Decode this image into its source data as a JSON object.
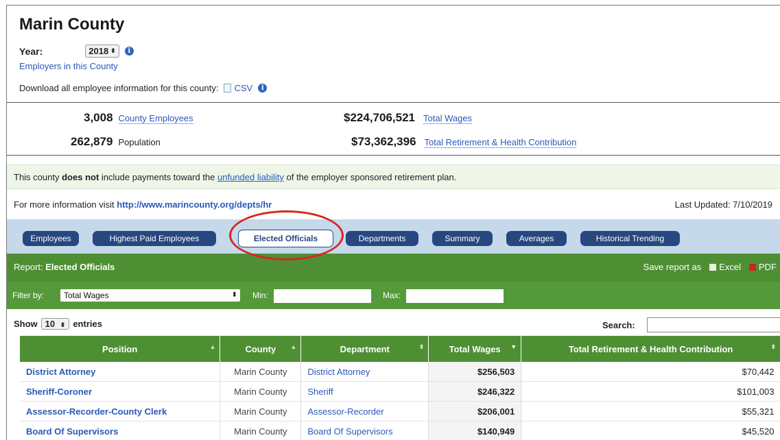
{
  "header": {
    "title": "Marin County",
    "year_label": "Year:",
    "year_value": "2018",
    "employers_link": "Employers in this County",
    "download_label": "Download all employee information for this county:",
    "csv_label": "CSV"
  },
  "stats": {
    "employees_num": "3,008",
    "employees_label": "County Employees",
    "population_num": "262,879",
    "population_label": "Population",
    "wages_num": "$224,706,521",
    "wages_label": "Total Wages",
    "retire_num": "$73,362,396",
    "retire_label": "Total Retirement & Health Contribution"
  },
  "notice": {
    "pre": "This county",
    "bold": "does not",
    "mid": "include payments toward the",
    "link": "unfunded liability",
    "post": "of the employer sponsored retirement plan."
  },
  "info": {
    "pre": "For more information visit",
    "url": "http://www.marincounty.org/depts/hr",
    "updated": "Last Updated: 7/10/2019"
  },
  "tabs": [
    "Employees",
    "Highest Paid Employees",
    "Elected Officials",
    "Departments",
    "Summary",
    "Averages",
    "Historical Trending"
  ],
  "report": {
    "label": "Report:",
    "name": "Elected Officials",
    "save_label": "Save report as",
    "excel": "Excel",
    "pdf": "PDF"
  },
  "filter": {
    "label": "Filter by:",
    "selected": "Total Wages",
    "min": "Min:",
    "max": "Max:"
  },
  "table_controls": {
    "show": "Show",
    "page_size": "10",
    "entries": "entries",
    "search": "Search:"
  },
  "table": {
    "columns": [
      "Position",
      "County",
      "Department",
      "Total Wages",
      "Total Retirement & Health Contribution"
    ],
    "rows": [
      [
        "District Attorney",
        "Marin County",
        "District Attorney",
        "$256,503",
        "$70,442"
      ],
      [
        "Sheriff-Coroner",
        "Marin County",
        "Sheriff",
        "$246,322",
        "$101,003"
      ],
      [
        "Assessor-Recorder-County Clerk",
        "Marin County",
        "Assessor-Recorder",
        "$206,001",
        "$55,321"
      ],
      [
        "Board Of Supervisors",
        "Marin County",
        "Board Of Supervisors",
        "$140,949",
        "$45,520"
      ]
    ]
  },
  "colors": {
    "link": "#2a59b8",
    "tab": "#27477f",
    "green": "#4e8f34",
    "highlight_circle": "#d8261f"
  }
}
